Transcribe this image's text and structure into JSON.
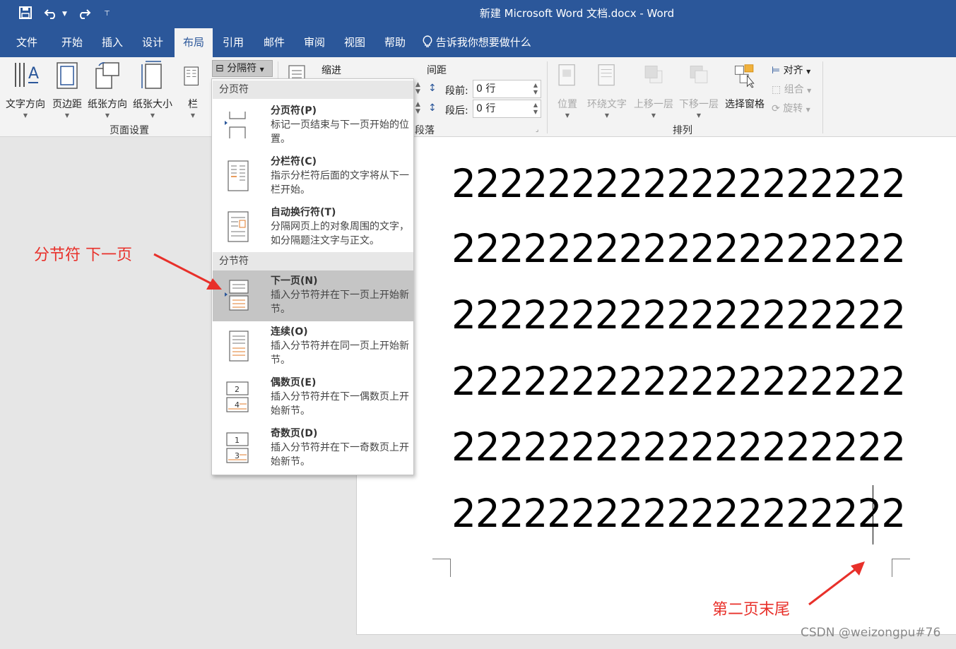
{
  "window": {
    "title": "新建 Microsoft Word 文档.docx  -  Word"
  },
  "tabs": [
    {
      "label": "文件"
    },
    {
      "label": "开始"
    },
    {
      "label": "插入"
    },
    {
      "label": "设计"
    },
    {
      "label": "布局"
    },
    {
      "label": "引用"
    },
    {
      "label": "邮件"
    },
    {
      "label": "审阅"
    },
    {
      "label": "视图"
    },
    {
      "label": "帮助"
    }
  ],
  "tell_me": "告诉我你想要做什么",
  "active_tab": "布局",
  "ribbon": {
    "page_setup": {
      "text_direction": "文字方向",
      "margins": "页边距",
      "orientation": "纸张方向",
      "size": "纸张大小",
      "columns": "栏",
      "breaks": "分隔符",
      "group_label": "页面设置"
    },
    "paragraph": {
      "indent": "缩进",
      "spacing": "间距",
      "before_label": "段前:",
      "before_value": "0 行",
      "after_label": "段后:",
      "after_value": "0 行",
      "group_label": "段落"
    },
    "arrange": {
      "position": "位置",
      "wrap_text": "环绕文字",
      "bring_forward": "上移一层",
      "send_backward": "下移一层",
      "selection_pane": "选择窗格",
      "align": "对齐",
      "group": "组合",
      "rotate": "旋转",
      "group_label": "排列"
    }
  },
  "breaks_menu": {
    "page_breaks_header": "分页符",
    "section_breaks_header": "分节符",
    "items": [
      {
        "title": "分页符(P)",
        "desc": "标记一页结束与下一页开始的位置。"
      },
      {
        "title": "分栏符(C)",
        "desc": "指示分栏符后面的文字将从下一栏开始。"
      },
      {
        "title": "自动换行符(T)",
        "desc": "分隔网页上的对象周围的文字，如分隔题注文字与正文。"
      },
      {
        "title": "下一页(N)",
        "desc": "插入分节符并在下一页上开始新节。",
        "highlighted": true
      },
      {
        "title": "连续(O)",
        "desc": "插入分节符并在同一页上开始新节。"
      },
      {
        "title": "偶数页(E)",
        "desc": "插入分节符并在下一偶数页上开始新节。"
      },
      {
        "title": "奇数页(D)",
        "desc": "插入分节符并在下一奇数页上开始新节。"
      }
    ]
  },
  "document": {
    "lines": [
      "2222222222222222222",
      "2222222222222222222",
      "2222222222222222222",
      "2222222222222222222",
      "2222222222222222222",
      "2222222222222222222"
    ]
  },
  "annotations": {
    "left": "分节符 下一页",
    "right": "第二页末尾",
    "color": "#e8302a"
  },
  "watermark": "CSDN @weizongpu#76",
  "colors": {
    "titlebar": "#2b579a",
    "ribbon": "#f3f3f3",
    "highlight": "#c5c5c5",
    "accent_orange": "#e07b29"
  }
}
